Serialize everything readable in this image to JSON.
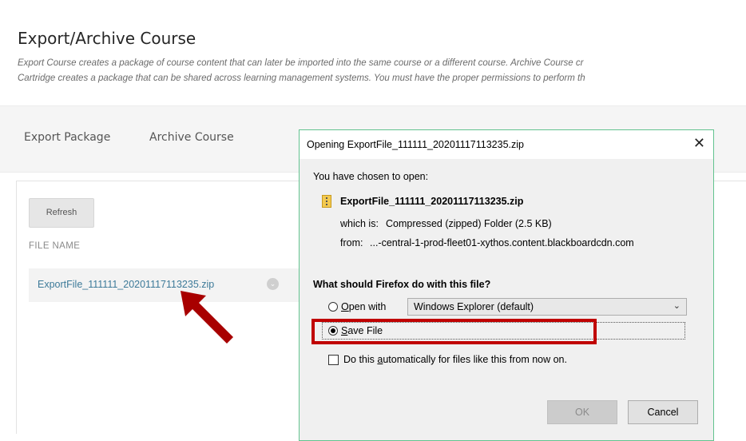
{
  "page": {
    "title": "Export/Archive Course",
    "description_line1": "Export Course creates a package of course content that can later be imported into the same course or a different course. Archive Course cr",
    "description_line2": "Cartridge creates a package that can be shared across learning management systems. You must have the proper permissions to perform th"
  },
  "tabs": [
    {
      "label": "Export Package"
    },
    {
      "label": "Archive Course"
    }
  ],
  "panel": {
    "refresh_label": "Refresh",
    "column_header": "FILE NAME",
    "file_link": "ExportFile_111111_20201117113235.zip"
  },
  "dialog": {
    "title": "Opening ExportFile_111111_20201117113235.zip",
    "chosen_text": "You have chosen to open:",
    "filename": "ExportFile_111111_20201117113235.zip",
    "which_is_label": "which is:",
    "which_is_value": "Compressed (zipped) Folder (2.5 KB)",
    "from_label": "from:",
    "from_value": "...-central-1-prod-fleet01-xythos.content.blackboardcdn.com",
    "question": "What should Firefox do with this file?",
    "open_with_prefix": "",
    "open_with_accel": "O",
    "open_with_rest": "pen with",
    "open_with_app": "Windows Explorer (default)",
    "save_accel": "S",
    "save_rest": "ave File",
    "auto_prefix": "Do this ",
    "auto_accel": "a",
    "auto_rest": "utomatically for files like this from now on.",
    "ok_label": "OK",
    "cancel_label": "Cancel",
    "save_selected": true,
    "auto_checked": false
  },
  "colors": {
    "dialog_border": "#62c38f",
    "highlight": "#c00000",
    "link": "#3d7a99",
    "arrow": "#a80000"
  }
}
